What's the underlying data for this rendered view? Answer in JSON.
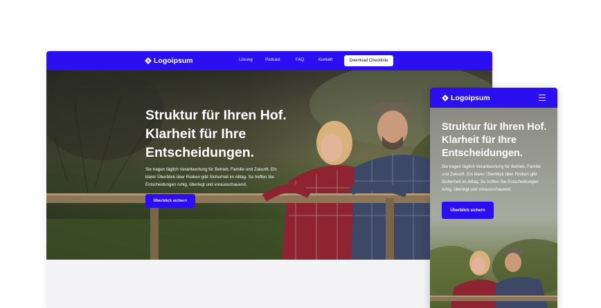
{
  "desktop": {
    "nav": {
      "logo_text": "Logoipsum",
      "links": [
        "Lösung",
        "Podcast",
        "FAQ",
        "Kontakt"
      ],
      "cta_label": "Download Checkliste"
    },
    "hero": {
      "title": "Struktur für Ihren Hof. Klarheit für Ihre Entscheidungen.",
      "description": "Sie tragen täglich Verantwortung für Betrieb, Familie und Zukunft. Ein klarer Überblick über Risiken gibt Sicherheit im Alltag. So treffen Sie Entscheidungen ruhig, überlegt und vorausschauend.",
      "button_label": "Überblick sichern"
    }
  },
  "mobile": {
    "nav": {
      "logo_text": "Logoipsum",
      "menu_icon": "hamburger-menu-icon"
    },
    "hero": {
      "title": "Struktur für Ihren Hof. Klarheit für Ihre Entscheidungen.",
      "description": "Sie tragen täglich Verantwortung für Betrieb, Familie und Zukunft. Ein klarer Überblick über Risiken gibt Sicherheit im Alltag. So treffen Sie Entscheidungen ruhig, überlegt und vorausschauend.",
      "button_label": "Überblick sichern"
    }
  },
  "colors": {
    "brand": "#2c0ff0",
    "page_background": "#ffffff",
    "section_background": "#f3f3f5"
  }
}
